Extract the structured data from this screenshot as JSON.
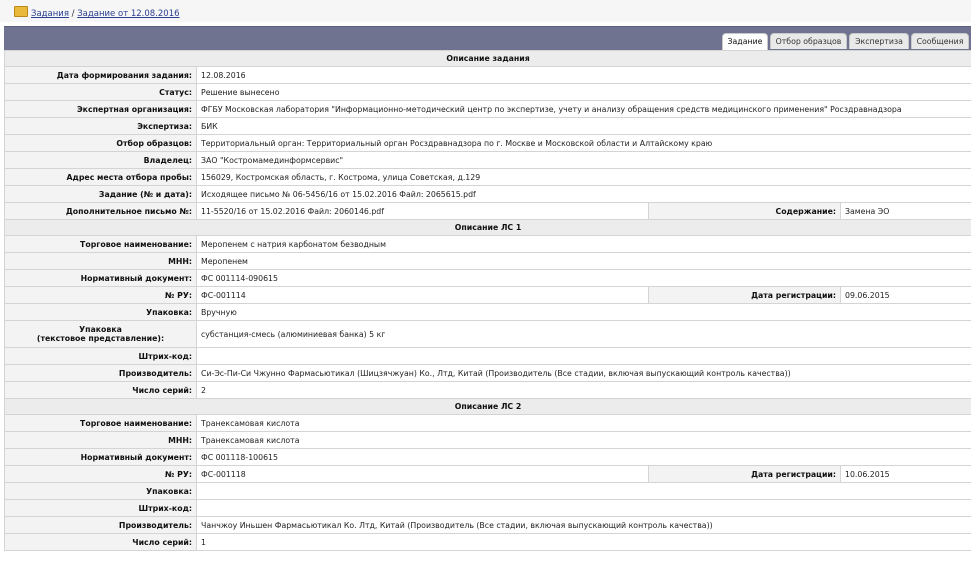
{
  "breadcrumb": {
    "root": "Задания",
    "sep": "/",
    "current": "Задание от 12.08.2016"
  },
  "tabs": [
    {
      "label": "Задание",
      "active": true
    },
    {
      "label": "Отбор образцов",
      "active": false
    },
    {
      "label": "Экспертиза",
      "active": false
    },
    {
      "label": "Сообщения",
      "active": false
    }
  ],
  "task": {
    "title": "Описание задания",
    "date_label": "Дата формирования задания:",
    "date_value": "12.08.2016",
    "status_label": "Статус:",
    "status_value": "Решение вынесено",
    "org_label": "Экспертная организация:",
    "org_value": "ФГБУ Московская лаборатория \"Информационно-методический центр по экспертизе, учету и анализу обращения средств медицинского применения\" Росздравнадзора",
    "expertise_label": "Экспертиза:",
    "expertise_value": "БИК",
    "sampling_label": "Отбор образцов:",
    "sampling_value": "Территориальный орган: Территориальный орган Росздравнадзора по г. Москве и Московской области и Алтайскому краю",
    "owner_label": "Владелец:",
    "owner_value": "ЗАО \"Костромамединформсервис\"",
    "address_label": "Адрес места отбора пробы:",
    "address_value": "156029, Костромская область, г. Кострома, улица Советская, д.129",
    "assignment_label": "Задание (№ и дата):",
    "assignment_value": "Исходящее письмо № 06-5456/16 от 15.02.2016  Файл: 2065615.pdf",
    "extra_label": "Дополнительное письмо №:",
    "extra_value": "11-5520/16 от 15.02.2016  Файл: 2060146.pdf",
    "content_label": "Содержание:",
    "content_value": "Замена ЭО"
  },
  "ls1": {
    "title": "Описание ЛС 1",
    "trade_label": "Торговое наименование:",
    "trade_value": "Меропенем с натрия карбонатом безводным",
    "mnn_label": "МНН:",
    "mnn_value": "Меропенем",
    "normdoc_label": "Нормативный документ:",
    "normdoc_value": "ФС 001114-090615",
    "ru_label": "№ РУ:",
    "ru_value": "ФС-001114",
    "regdate_label": "Дата регистрации:",
    "regdate_value": "09.06.2015",
    "pack_label": "Упаковка:",
    "pack_value": "Вручную",
    "packtext_label1": "Упаковка",
    "packtext_label2": "(текстовое представление):",
    "packtext_value": "субстанция-смесь (алюминиевая банка) 5 кг",
    "barcode_label": "Штрих-код:",
    "barcode_value": "",
    "producer_label": "Производитель:",
    "producer_value": "Си-Эс-Пи-Си Чжунно Фармасьютикал (Шицзячжуан) Ко., Лтд, Китай (Производитель (Все стадии, включая выпускающий контроль качества))",
    "series_label": "Число серий:",
    "series_value": "2"
  },
  "ls2": {
    "title": "Описание ЛС 2",
    "trade_label": "Торговое наименование:",
    "trade_value": "Транексамовая кислота",
    "mnn_label": "МНН:",
    "mnn_value": "Транексамовая кислота",
    "normdoc_label": "Нормативный документ:",
    "normdoc_value": "ФС 001118-100615",
    "ru_label": "№ РУ:",
    "ru_value": "ФС-001118",
    "regdate_label": "Дата регистрации:",
    "regdate_value": "10.06.2015",
    "pack_label": "Упаковка:",
    "pack_value": "",
    "barcode_label": "Штрих-код:",
    "barcode_value": "",
    "producer_label": "Производитель:",
    "producer_value": "Чанчжоу Иньшен Фармасьютикал Ко. Лтд, Китай (Производитель (Все стадии, включая выпускающий контроль качества))",
    "series_label": "Число серий:",
    "series_value": "1"
  },
  "colors": {
    "bar": "#6f7390",
    "link": "#2a3f8f",
    "folder": "#e8b93b"
  }
}
